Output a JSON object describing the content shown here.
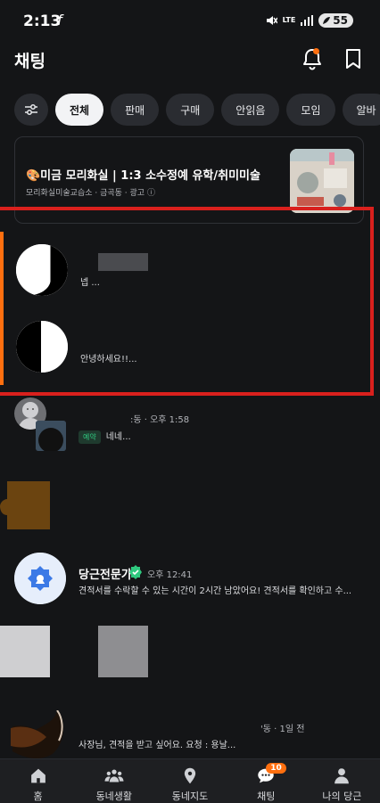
{
  "status": {
    "time": "2:13",
    "f_glyph": "f",
    "lte": "LTE",
    "battery": "55"
  },
  "header": {
    "title": "채팅"
  },
  "chips": [
    "전체",
    "판매",
    "구매",
    "안읽음",
    "모임",
    "알바"
  ],
  "ad": {
    "title": "🎨미금 모리화실 | 1:3 소수정예 유학/취미미술",
    "meta": "모리화실미술교습소 · 금곡동 · 광고 ⓘ"
  },
  "chats": [
    {
      "message": "넵 ..."
    },
    {
      "message": "안녕하세요!!..."
    },
    {
      "meta": ":동 · 오후 1:58",
      "tag": "예약",
      "message": "네네..."
    },
    {
      "name": "당근전문가",
      "meta": "오후 12:41",
      "message": "견적서를 수락할 수 있는 시간이 2시간 남았어요!  견적서를 확인하고 수..."
    },
    {
      "meta": "'동 · 1일 전",
      "message": "사장님, 견적을 받고 싶어요. 요청 : 용날..."
    }
  ],
  "nav": {
    "items": [
      {
        "label": "홈",
        "icon": "home-icon"
      },
      {
        "label": "동네생활",
        "icon": "community-icon"
      },
      {
        "label": "동네지도",
        "icon": "map-pin-icon"
      },
      {
        "label": "채팅",
        "icon": "chat-icon",
        "badge": "10"
      },
      {
        "label": "나의 당근",
        "icon": "person-icon"
      }
    ]
  },
  "colors": {
    "accent": "#ff6f0f",
    "highlight_border": "#d9201d",
    "background": "#141517",
    "verified": "#2fc97f"
  }
}
